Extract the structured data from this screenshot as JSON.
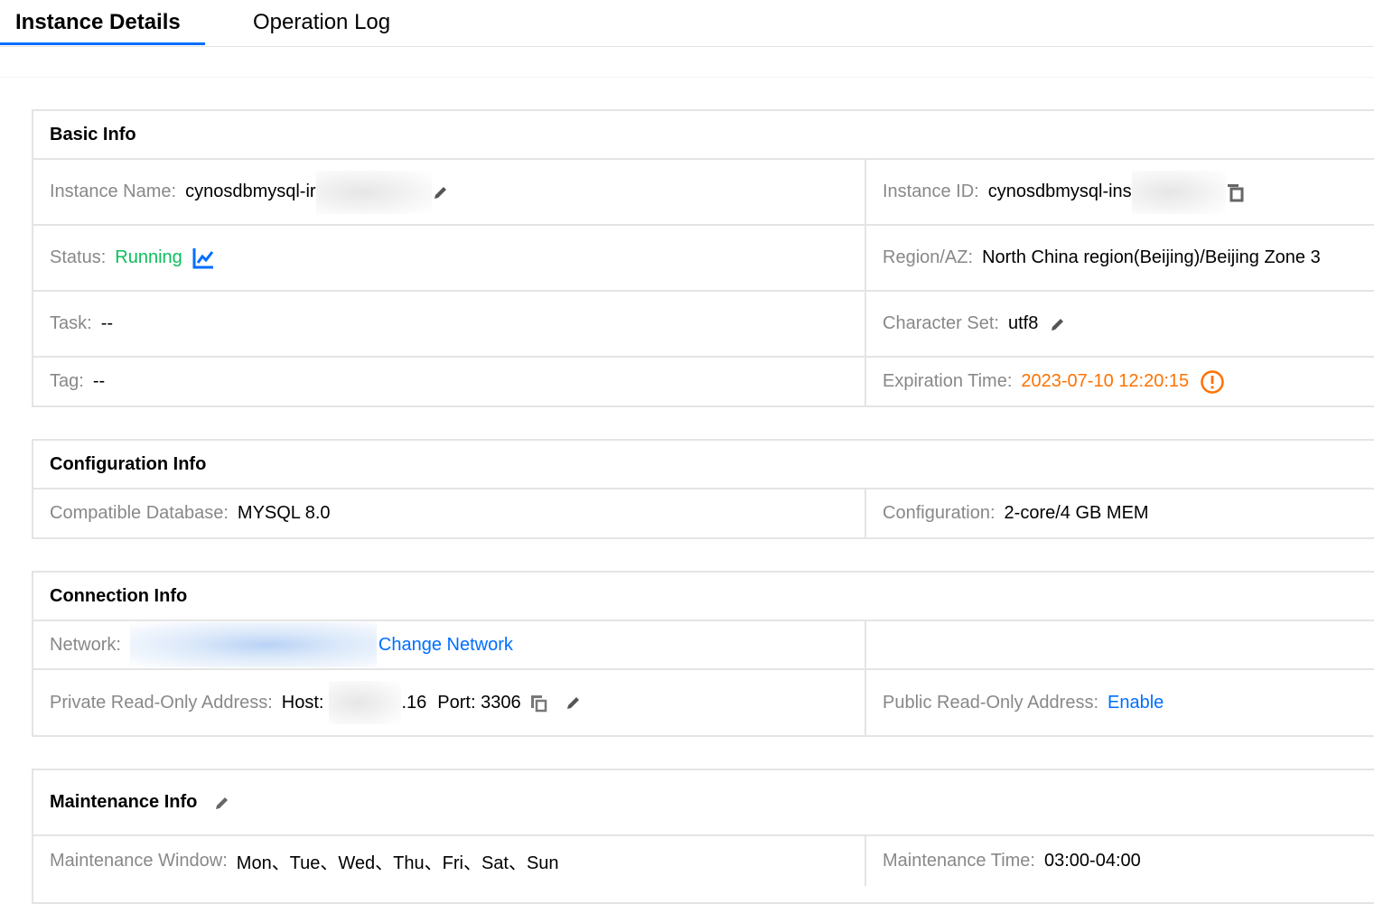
{
  "tabs": [
    {
      "label": "Instance Details",
      "active": true
    },
    {
      "label": "Operation Log",
      "active": false
    }
  ],
  "separator": ":",
  "basic_info": {
    "title": "Basic Info",
    "instance_name": {
      "label": "Instance Name",
      "value": "cynosdbmysql-ir"
    },
    "instance_id": {
      "label": "Instance ID",
      "value": "cynosdbmysql-ins"
    },
    "status": {
      "label": "Status",
      "value": "Running"
    },
    "region": {
      "label": "Region/AZ",
      "value": "North China region(Beijing)/Beijing Zone 3"
    },
    "task": {
      "label": "Task",
      "value": "--"
    },
    "charset": {
      "label": "Character Set",
      "value": "utf8"
    },
    "tag": {
      "label": "Tag",
      "value": "--"
    },
    "expiration": {
      "label": "Expiration Time",
      "value": "2023-07-10 12:20:15"
    }
  },
  "config_info": {
    "title": "Configuration Info",
    "compatible_db": {
      "label": "Compatible Database",
      "value": "MYSQL 8.0"
    },
    "configuration": {
      "label": "Configuration",
      "value": "2-core/4 GB MEM"
    }
  },
  "connection_info": {
    "title": "Connection Info",
    "network": {
      "label": "Network",
      "link": "Change Network"
    },
    "private_ro": {
      "label": "Private Read-Only Address",
      "host_label": "Host:",
      "host_suffix": ".16",
      "port_text": "Port: 3306"
    },
    "public_ro": {
      "label": "Public Read-Only Address",
      "link": "Enable"
    }
  },
  "maintenance_info": {
    "title": "Maintenance Info",
    "window": {
      "label": "Maintenance Window",
      "value": "Mon、Tue、Wed、Thu、Fri、Sat、Sun"
    },
    "time": {
      "label": "Maintenance Time",
      "value": "03:00-04:00"
    }
  },
  "colors": {
    "accent": "#006eff",
    "running": "#0abf5b",
    "warning": "#ff7200",
    "label": "#888888",
    "border": "#e4e4e4"
  },
  "icons": {
    "edit": "pencil-icon",
    "copy": "copy-icon",
    "monitor": "line-chart-icon",
    "warning": "exclamation-circle-icon"
  }
}
